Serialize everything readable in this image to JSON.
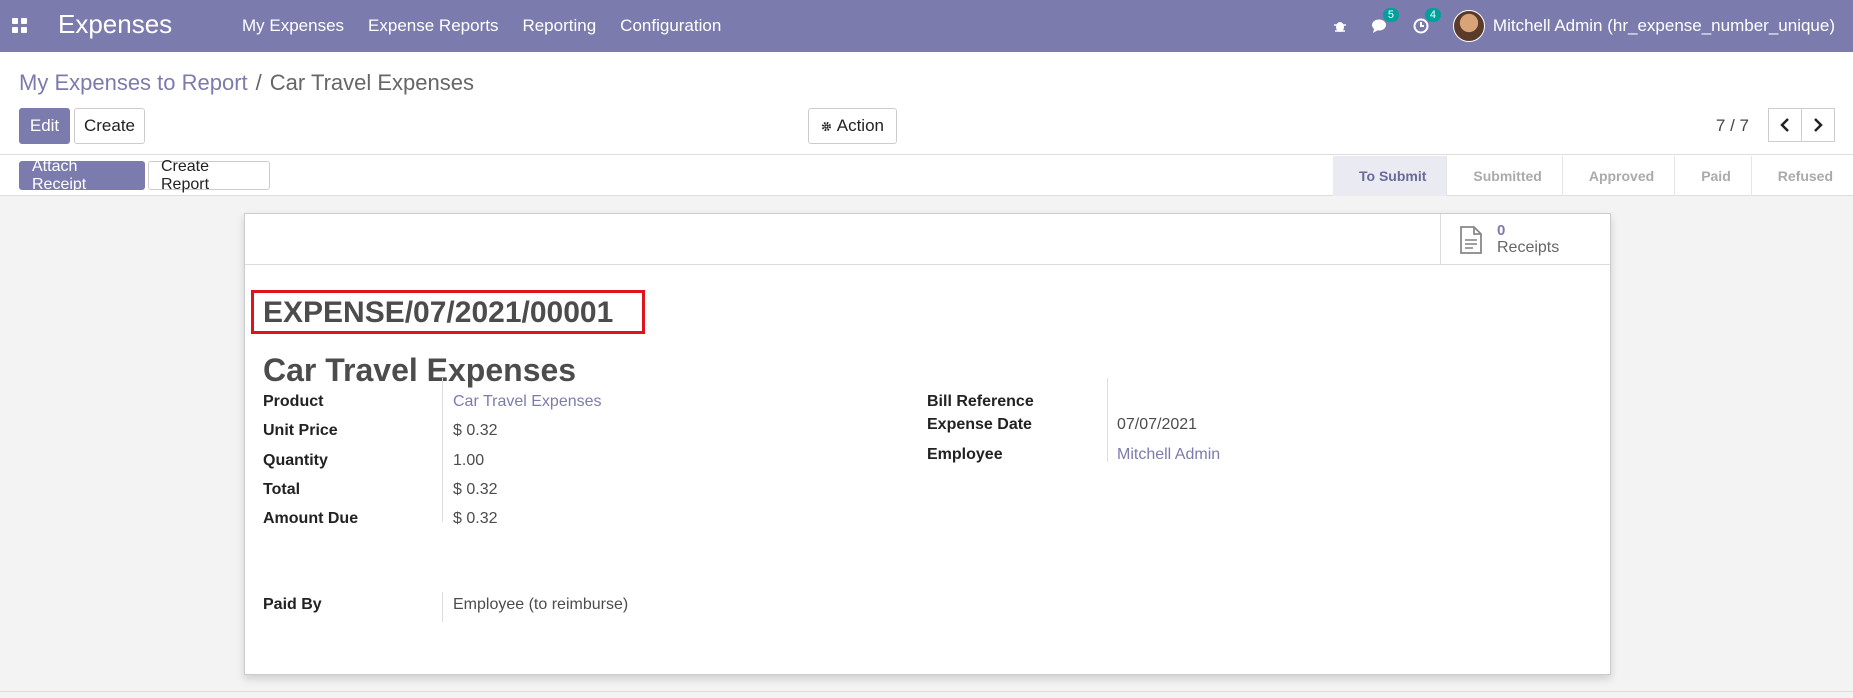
{
  "navbar": {
    "app_title": "Expenses",
    "menu": [
      "My Expenses",
      "Expense Reports",
      "Reporting",
      "Configuration"
    ],
    "messages_count": "5",
    "activities_count": "4",
    "user_name": "Mitchell Admin (hr_expense_number_unique)"
  },
  "breadcrumb": {
    "parent": "My Expenses to Report",
    "separator": "/",
    "current": "Car Travel Expenses"
  },
  "buttons": {
    "edit": "Edit",
    "create": "Create",
    "action": "Action",
    "attach_receipt": "Attach Receipt",
    "create_report": "Create Report"
  },
  "pager": {
    "text": "7 / 7"
  },
  "status_stages": [
    "To Submit",
    "Submitted",
    "Approved",
    "Paid",
    "Refused"
  ],
  "status_active": "To Submit",
  "receipts": {
    "count": "0",
    "label": "Receipts"
  },
  "record": {
    "reference": "EXPENSE/07/2021/00001",
    "name": "Car Travel Expenses"
  },
  "fields_left": [
    {
      "label": "Product",
      "value": "Car Travel Expenses"
    },
    {
      "label": "Unit Price",
      "value": "$ 0.32"
    },
    {
      "label": "Quantity",
      "value": "1.00"
    },
    {
      "label": "Total",
      "value": "$ 0.32"
    },
    {
      "label": "Amount Due",
      "value": "$ 0.32"
    }
  ],
  "paid_by": {
    "label": "Paid By",
    "value": "Employee (to reimburse)"
  },
  "fields_right": [
    {
      "label": "Bill Reference",
      "value": ""
    },
    {
      "label": "Expense Date",
      "value": "07/07/2021"
    },
    {
      "label": "Employee",
      "value": "Mitchell Admin"
    }
  ],
  "colors": {
    "brand": "#7c7bad",
    "badge": "#00a09d",
    "highlight": "#e0131c"
  }
}
